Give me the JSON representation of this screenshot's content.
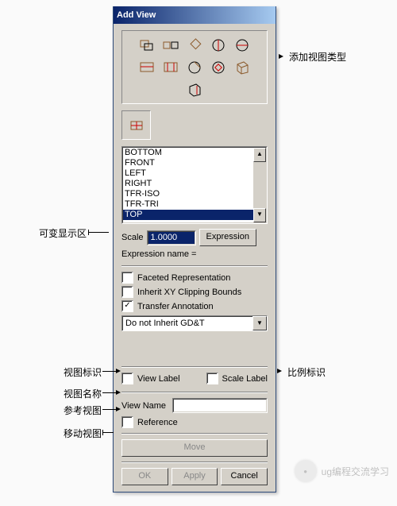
{
  "title": "Add View",
  "list": {
    "items": [
      "BOTTOM",
      "FRONT",
      "LEFT",
      "RIGHT",
      "TFR-ISO",
      "TFR-TRI",
      "TOP"
    ],
    "selected": 6
  },
  "scale": {
    "label": "Scale",
    "value": "1.0000",
    "expr_btn": "Expression"
  },
  "expr_name": "Expression name =",
  "checks": {
    "faceted": {
      "label": "Faceted Representation",
      "on": false
    },
    "clip": {
      "label": "Inherit XY Clipping Bounds",
      "on": false
    },
    "xfer": {
      "label": "Transfer Annotation",
      "on": true
    }
  },
  "combo": {
    "value": "Do not Inherit GD&T"
  },
  "labels": {
    "view_label": "View Label",
    "scale_label": "Scale Label",
    "view_name": "View Name",
    "reference": "Reference",
    "view_name_val": ""
  },
  "checks2": {
    "viewlabel": false,
    "scalelabel": false,
    "reference": false
  },
  "move": "Move",
  "buttons": {
    "ok": "OK",
    "apply": "Apply",
    "cancel": "Cancel"
  },
  "annotations": {
    "viewtype": "添加视图类型",
    "vardisp": "可变显示区",
    "viewlabel": "视图标识",
    "scalelabel": "比例标识",
    "viewname": "视图名称",
    "refview": "参考视图",
    "moveview": "移动视图",
    "watermark": "ug编程交流学习"
  }
}
